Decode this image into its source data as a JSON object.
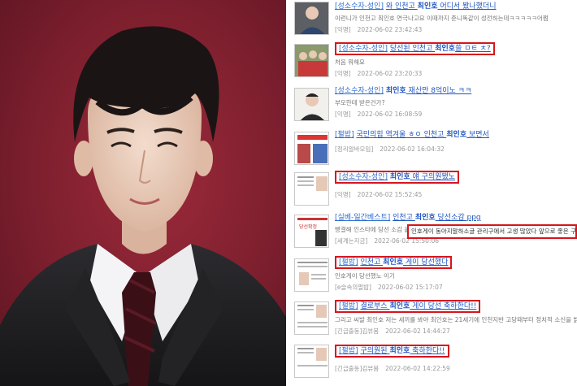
{
  "items": [
    {
      "category": "[성소수자-성인]",
      "title_pre": "와 인천고 ",
      "name": "최인호",
      "title_post": " 어디서 봤나했더니",
      "snippet": "이런니가 인천고 최인호 연극나고요 이때까지 준니똑같이 성전하는데ㅋㅋㅋㅋㅋ어쩜",
      "source": "[익명]",
      "date": "2022-06-02 23:42:43",
      "highlight": false
    },
    {
      "category": "[성소수자-성인]",
      "title_pre": "당선된 인천고 ",
      "name": "최인호",
      "title_post": "쓸 ㅁㅌ ㅊ?",
      "snippet": "처음 뭐해요",
      "source": "[익명]",
      "date": "2022-06-02 23:20:33",
      "highlight": true
    },
    {
      "category": "[성소수자-성인]",
      "title_pre": "",
      "name": "최인호",
      "title_post": " 재산만 8억이노 ㅋㅋ",
      "snippet": "부모한테 받은건가?",
      "source": "[익명]",
      "date": "2022-06-02 16:08:59",
      "highlight": false
    },
    {
      "category": "[펄밥]",
      "title_pre": "국민의힘 역겨울 ㅎㅇ 인천고 ",
      "name": "최인호",
      "title_post": " 보면서",
      "snippet": "",
      "source": "[정리알바모임]",
      "date": "2022-06-02 16:04:32",
      "highlight": false
    },
    {
      "category": "[성소수자-성인]",
      "title_pre": "",
      "name": "최인호",
      "title_post": " 얘 구의원됐노",
      "snippet": "",
      "source": "[익명]",
      "date": "2022-06-02 15:52:45",
      "highlight": true
    },
    {
      "category": "[실베-일간베스트]",
      "title_pre": "인천고 ",
      "name": "최인호",
      "title_post": " 당선소감 ppg",
      "snippet": "빵결해 인스타에 당선 소감 올려둔",
      "source": "[세계는지금]",
      "date": "2022-06-02 15:50:06",
      "highlight": false
    },
    {
      "category": "[펄밥]",
      "title_pre": "인천고 ",
      "name": "최인호",
      "title_post": " 게이 당선했다",
      "snippet": "인호게이 당선했노 이기",
      "source": "[e슬속의펄밥]",
      "date": "2022-06-02 15:17:07",
      "highlight": true
    },
    {
      "category": "[펄밥]",
      "title_pre": "결로부스 ",
      "name": "최인호",
      "title_post": " 게이 당선 축하한다!!",
      "snippet": "그리고 씨발 최인호 저는 세끼를 봐야 최인호는 21세기에 인천지반 고당때부터 정치적 소신을 밝히고 운각",
      "source": "[긴급출동]김뷰봄",
      "date": "2022-06-02 14:44:27",
      "highlight": true
    },
    {
      "category": "[펄밥]",
      "title_pre": "구의원된 ",
      "name": "최인호",
      "title_post": " 축하한다!!",
      "snippet": "",
      "source": "[긴급출동]김뷰봄",
      "date": "2022-06-02 14:22:59",
      "highlight": true
    }
  ],
  "callout_text": "인호게이 동아지말하소글 관리구에서 고생 많았다 앞으로 좋은 구청활동 "
}
